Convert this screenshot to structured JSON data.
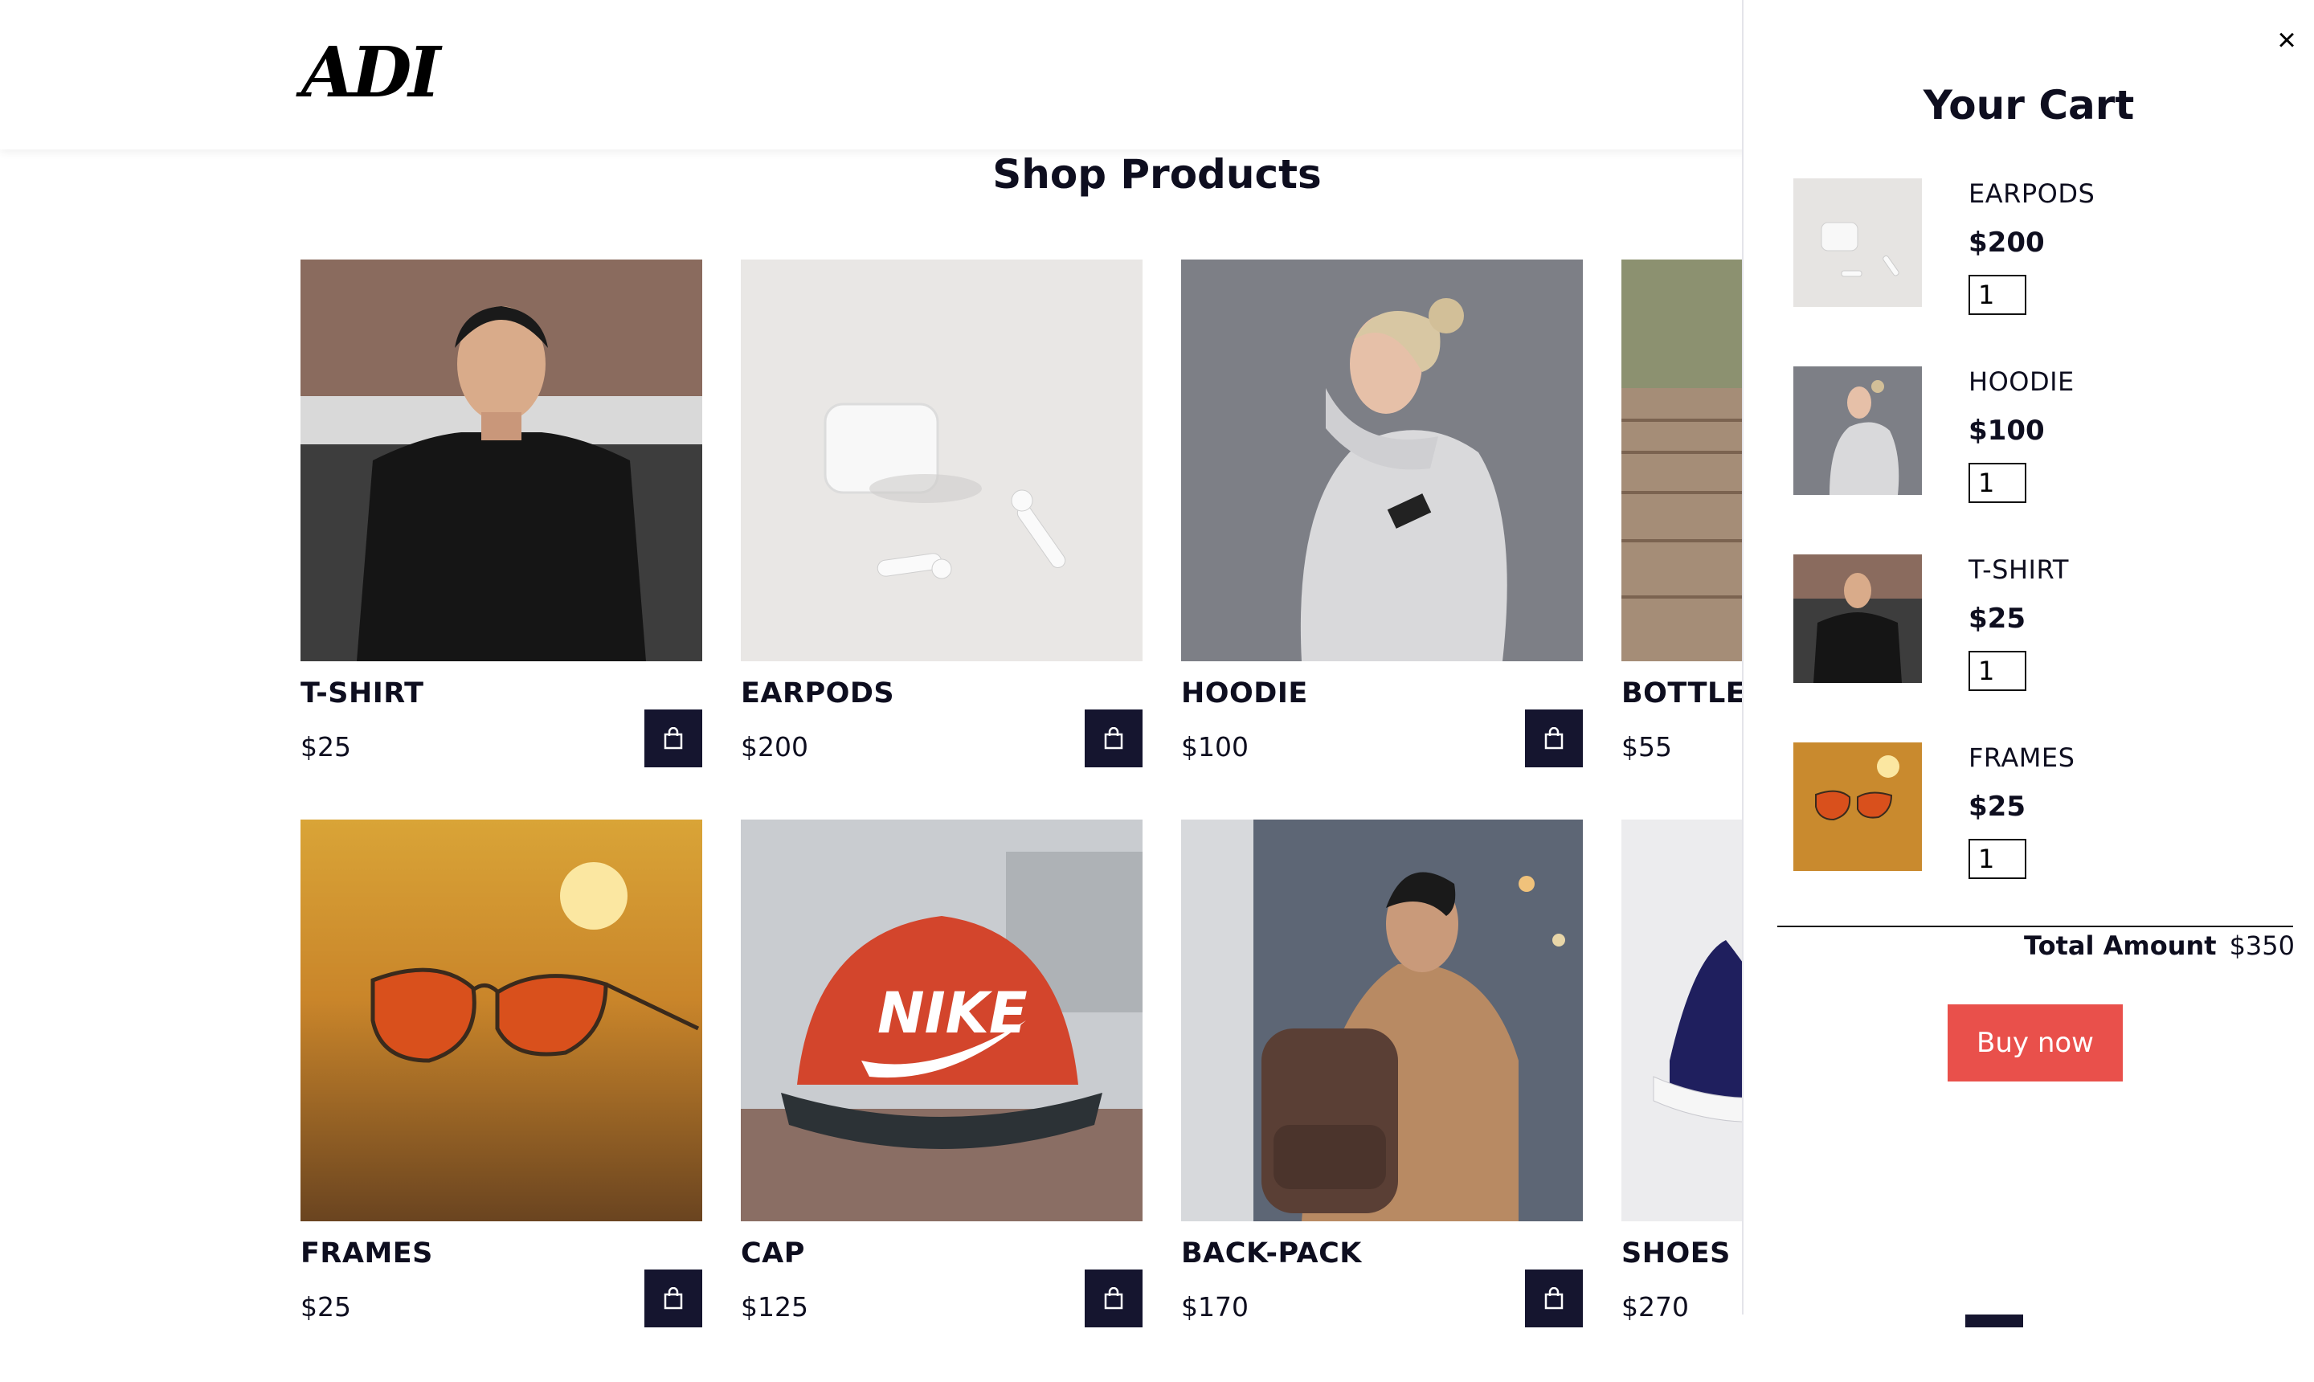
{
  "header": {
    "logo_text": "ADI"
  },
  "main": {
    "title": "Shop Products",
    "products": [
      {
        "name": "T-SHIRT",
        "price": "$25"
      },
      {
        "name": "EARPODS",
        "price": "$200"
      },
      {
        "name": "HOODIE",
        "price": "$100"
      },
      {
        "name": "BOTTLE",
        "price": "$55"
      },
      {
        "name": "FRAMES",
        "price": "$25"
      },
      {
        "name": "CAP",
        "price": "$125"
      },
      {
        "name": "BACK-PACK",
        "price": "$170"
      },
      {
        "name": "SHOES",
        "price": "$270"
      }
    ]
  },
  "cart": {
    "close_icon": "×",
    "title": "Your Cart",
    "items": [
      {
        "name": "EARPODS",
        "price": "$200",
        "qty": "1"
      },
      {
        "name": "HOODIE",
        "price": "$100",
        "qty": "1"
      },
      {
        "name": "T-SHIRT",
        "price": "$25",
        "qty": "1"
      },
      {
        "name": "FRAMES",
        "price": "$25",
        "qty": "1"
      }
    ],
    "total_label": "Total Amount",
    "total_value": "$350",
    "buy_label": "Buy now"
  },
  "colors": {
    "dark": "#15152f",
    "accent": "#e9504b"
  },
  "icons": {
    "bag": "shopping-bag-icon",
    "trash": "trash-icon",
    "close": "close-icon"
  }
}
